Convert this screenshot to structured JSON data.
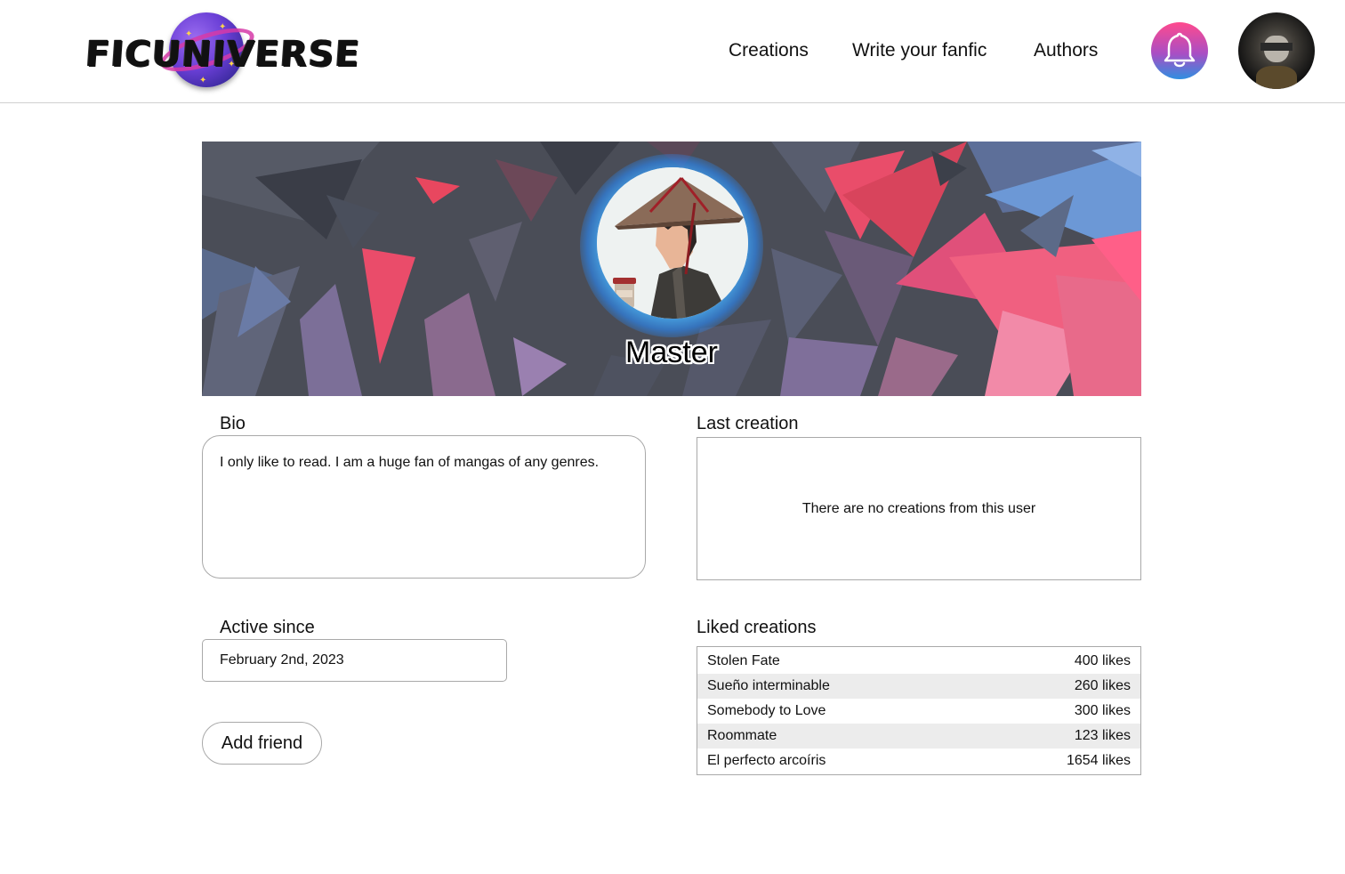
{
  "app": {
    "logo_text": "FICUNIVERSE",
    "accent_colors": {
      "bell_top": "#ff4a8d",
      "bell_mid": "#a94ec4",
      "bell_bottom": "#2f8fe0"
    }
  },
  "header": {
    "nav": [
      {
        "label": "Creations"
      },
      {
        "label": "Write your fanfic"
      },
      {
        "label": "Authors"
      }
    ],
    "notification_icon": "bell-icon",
    "user_avatar_icon": "avatar"
  },
  "profile": {
    "name": "Master",
    "banner_style": "low-poly red/blue/grey shards"
  },
  "bio": {
    "title": "Bio",
    "text": "I only like to read. I am a huge fan of mangas of any genres."
  },
  "last_creation": {
    "title": "Last creation",
    "empty_text": "There are no creations from this user"
  },
  "active_since": {
    "title": "Active since",
    "value": "February 2nd, 2023"
  },
  "actions": {
    "add_friend_label": "Add friend"
  },
  "liked_creations": {
    "title": "Liked creations",
    "items": [
      {
        "title": "Stolen Fate",
        "likes": "400 likes"
      },
      {
        "title": "Sueño interminable",
        "likes": "260 likes"
      },
      {
        "title": "Somebody to Love",
        "likes": "300 likes"
      },
      {
        "title": "Roommate",
        "likes": "123 likes"
      },
      {
        "title": "El perfecto arcoíris",
        "likes": "1654 likes"
      }
    ]
  }
}
